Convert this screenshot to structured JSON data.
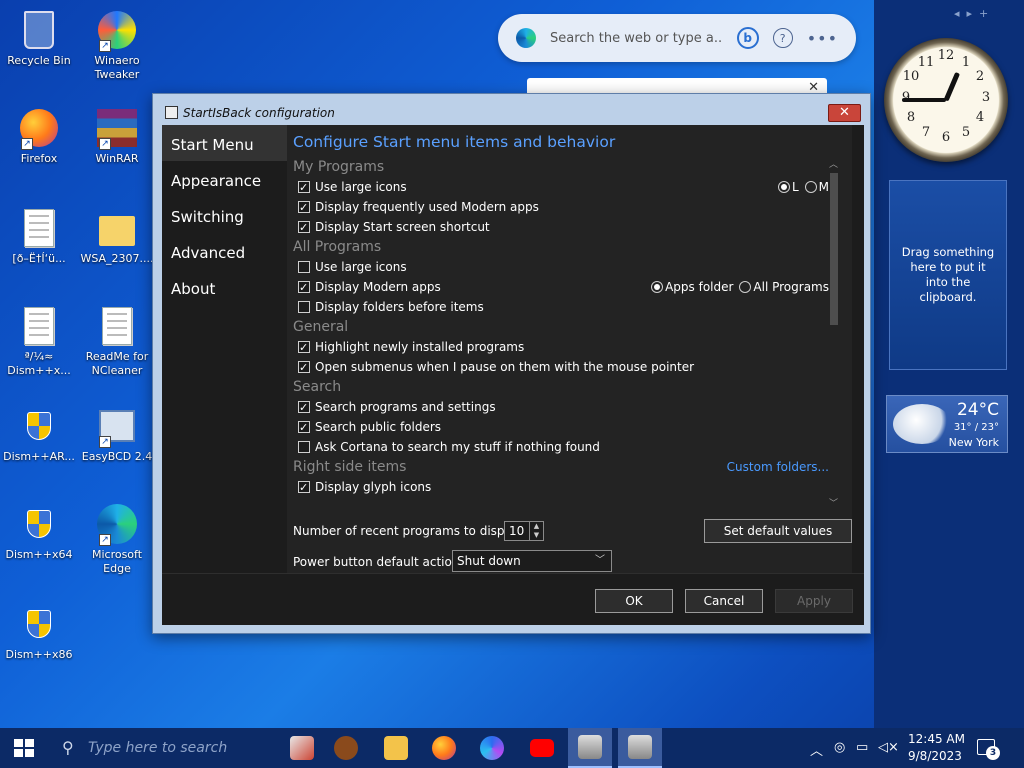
{
  "desktop_icons": [
    {
      "label": "Recycle Bin",
      "icon": "recycle-bin-icon"
    },
    {
      "label": "Winaero Tweaker",
      "icon": "winaero-tweaker-icon"
    },
    {
      "label": "Firefox",
      "icon": "firefox-icon"
    },
    {
      "label": "WinRAR",
      "icon": "winrar-icon"
    },
    {
      "label": "[ð–Ë†Í‘ü...",
      "icon": "document-icon"
    },
    {
      "label": "WSA_2307....",
      "icon": "folder-icon"
    },
    {
      "label": "ª/¼≈ Dism++x...",
      "icon": "document-icon"
    },
    {
      "label": "ReadMe for NCleaner",
      "icon": "document-icon"
    },
    {
      "label": "Dism++AR...",
      "icon": "shield-icon"
    },
    {
      "label": "EasyBCD 2.4",
      "icon": "easybcd-icon"
    },
    {
      "label": "Dism++x64",
      "icon": "shield-icon"
    },
    {
      "label": "Microsoft Edge",
      "icon": "edge-icon"
    },
    {
      "label": "Dism++x86",
      "icon": "shield-icon"
    }
  ],
  "search_bar": {
    "placeholder": "Search the web or type a..."
  },
  "gadgets": {
    "clock": {
      "time": "12:45"
    },
    "clipboard_text": "Drag something here to put it into the clipboard.",
    "weather": {
      "temp": "24°C",
      "range": "31° / 23°",
      "city": "New York"
    }
  },
  "dialog": {
    "title": "StartIsBack configuration",
    "close_label": "✕",
    "nav": [
      "Start Menu",
      "Appearance",
      "Switching",
      "Advanced",
      "About"
    ],
    "selected_nav": "Start Menu",
    "heading": "Configure Start menu items and behavior",
    "sections": [
      {
        "title": "My Programs",
        "items": [
          {
            "label": "Use large icons",
            "checked": true,
            "radios": [
              {
                "label": "L",
                "selected": true
              },
              {
                "label": "M",
                "selected": false
              }
            ]
          },
          {
            "label": "Display frequently used Modern apps",
            "checked": true
          },
          {
            "label": "Display Start screen shortcut",
            "checked": true
          }
        ]
      },
      {
        "title": "All Programs",
        "items": [
          {
            "label": "Use large icons",
            "checked": false
          },
          {
            "label": "Display Modern apps",
            "checked": true,
            "radios": [
              {
                "label": "Apps folder",
                "selected": true
              },
              {
                "label": "All Programs",
                "selected": false
              }
            ]
          },
          {
            "label": "Display folders before items",
            "checked": false
          }
        ]
      },
      {
        "title": "General",
        "items": [
          {
            "label": "Highlight newly installed programs",
            "checked": true
          },
          {
            "label": "Open submenus when I pause on them with the mouse pointer",
            "checked": true
          }
        ]
      },
      {
        "title": "Search",
        "items": [
          {
            "label": "Search programs and settings",
            "checked": true
          },
          {
            "label": "Search public folders",
            "checked": true
          },
          {
            "label": "Ask Cortana to search my stuff if nothing found",
            "checked": false
          }
        ]
      },
      {
        "title": "Right side items",
        "link": "Custom folders...",
        "items": [
          {
            "label": "Display glyph icons",
            "checked": true
          }
        ]
      }
    ],
    "recent_label": "Number of recent programs to display:",
    "recent_value": "10",
    "set_default_label": "Set default values",
    "power_label": "Power button default action:",
    "power_value": "Shut down",
    "ok_label": "OK",
    "cancel_label": "Cancel",
    "apply_label": "Apply"
  },
  "taskbar": {
    "search_placeholder": "Type here to search",
    "time": "12:45 AM",
    "date": "9/8/2023",
    "notification_count": "3",
    "apps": [
      "football-game-icon",
      "football-icon",
      "file-explorer-icon",
      "firefox-icon",
      "copilot-icon",
      "youtube-icon",
      "startisback-icon",
      "config-window-icon"
    ]
  }
}
